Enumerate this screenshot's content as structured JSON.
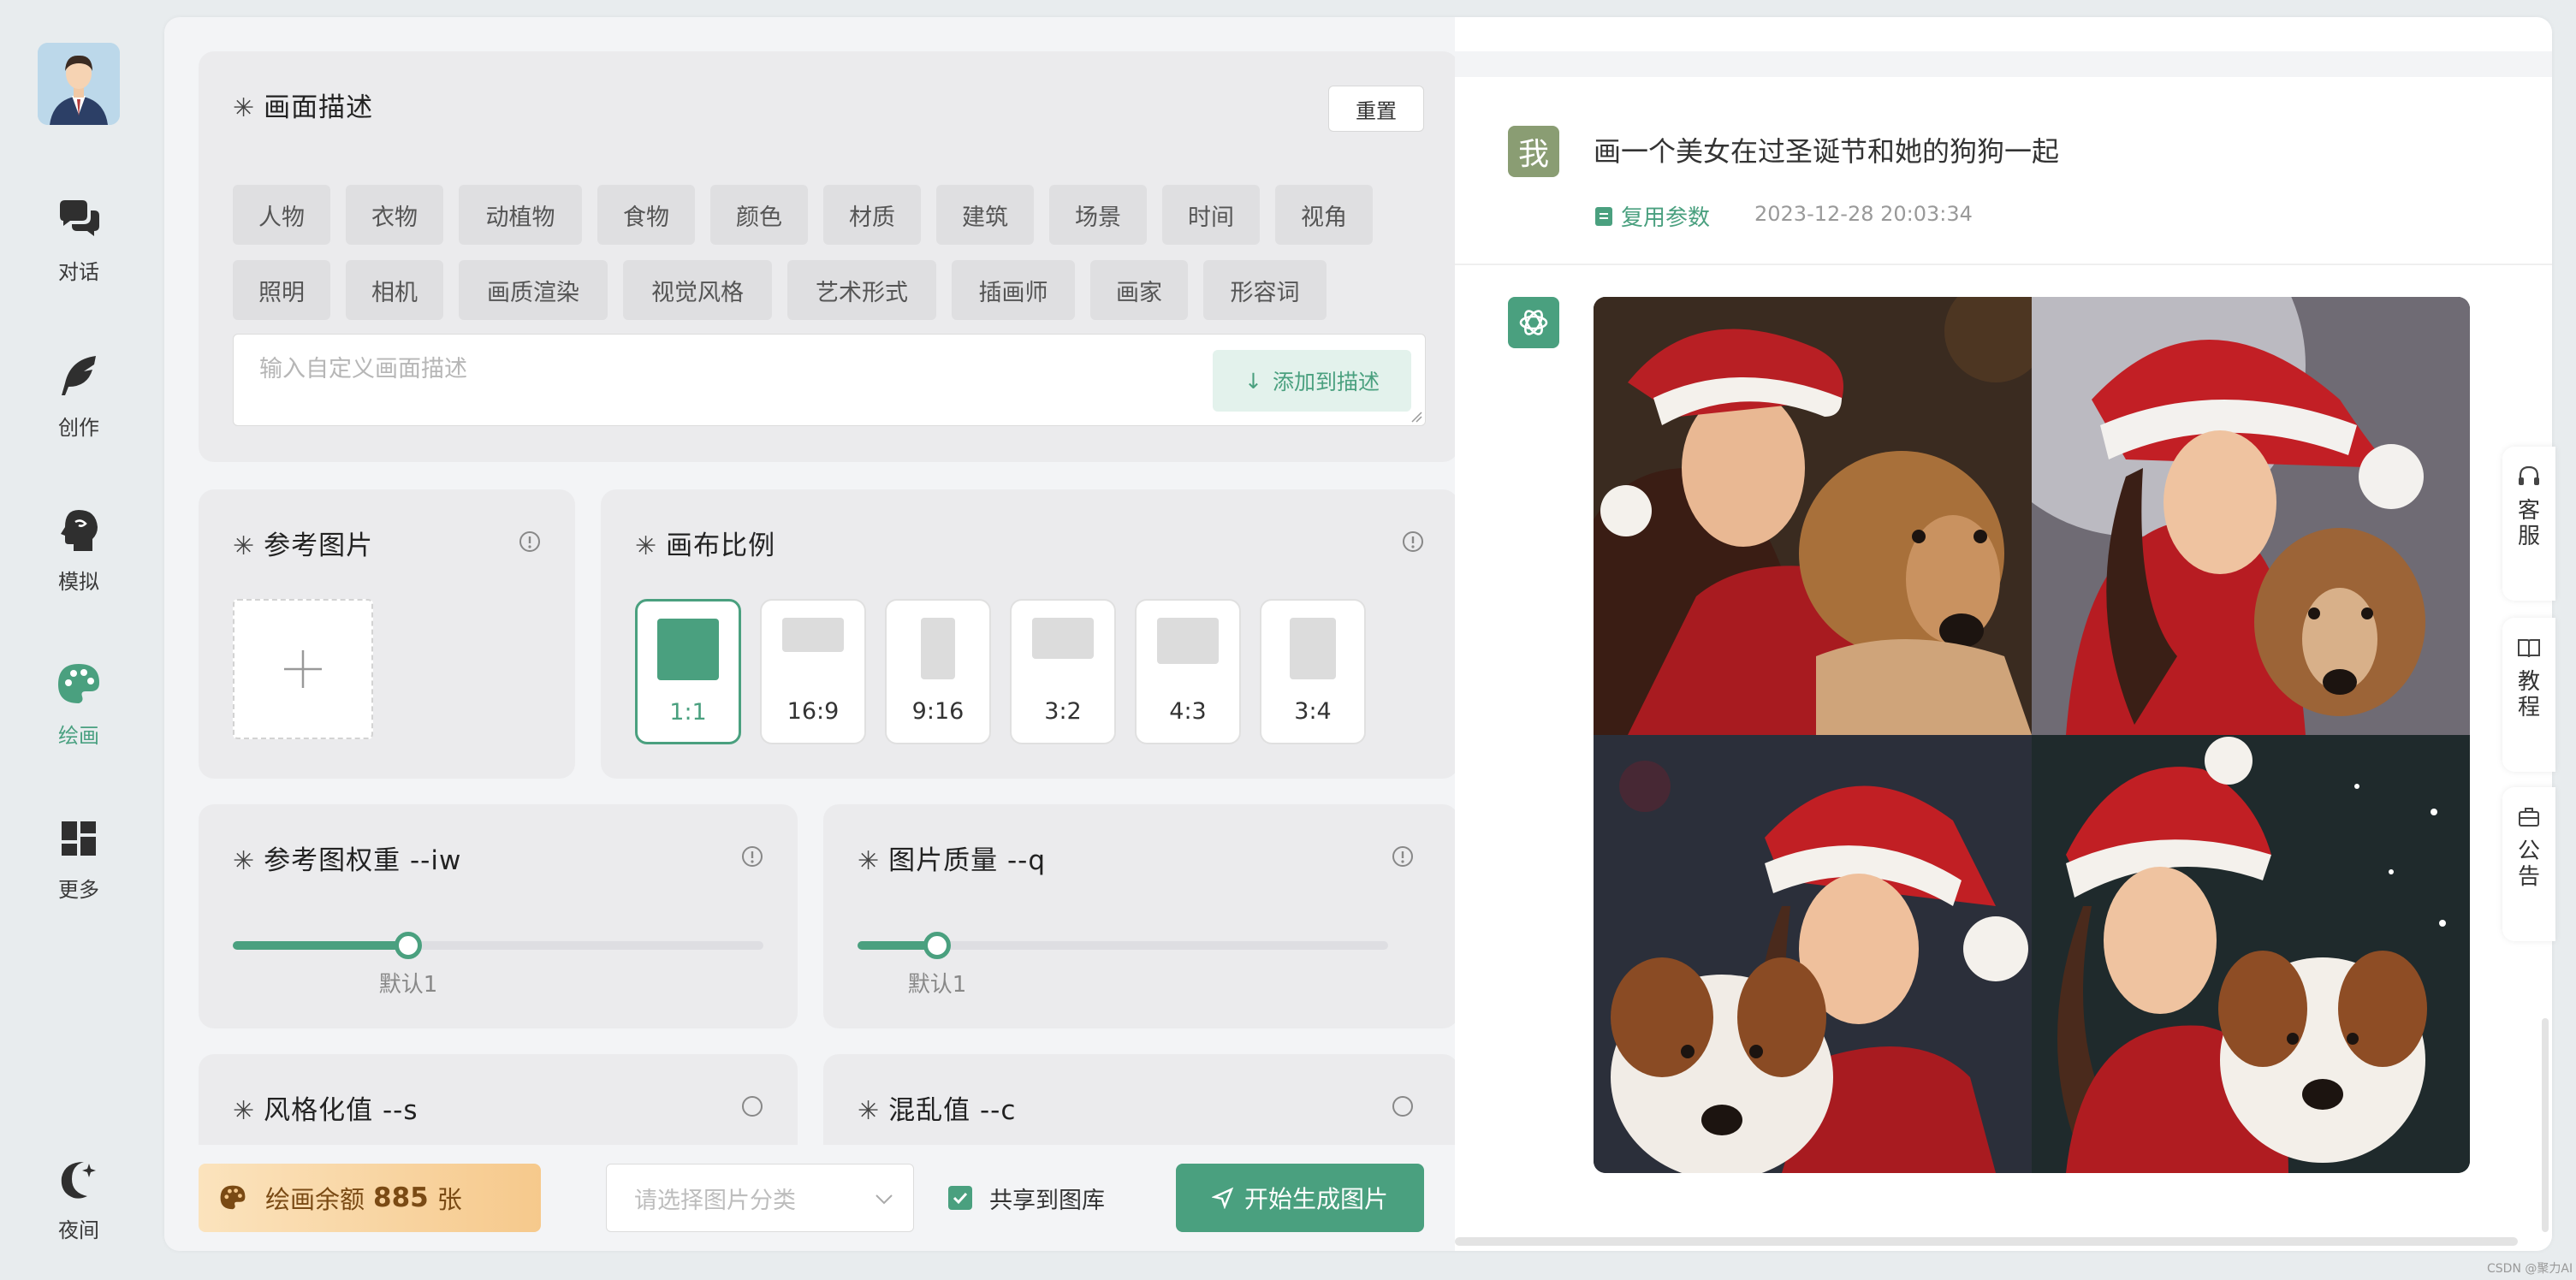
{
  "nav": {
    "items": [
      {
        "label": "对话",
        "icon": "chat-bubbles-icon"
      },
      {
        "label": "创作",
        "icon": "feather-icon"
      },
      {
        "label": "模拟",
        "icon": "head-profile-icon"
      },
      {
        "label": "绘画",
        "icon": "palette-icon",
        "active": true
      },
      {
        "label": "更多",
        "icon": "grid-icon"
      }
    ],
    "night_label": "夜间"
  },
  "description": {
    "title": "画面描述",
    "reset_label": "重置",
    "tags": [
      "人物",
      "衣物",
      "动植物",
      "食物",
      "颜色",
      "材质",
      "建筑",
      "场景",
      "时间",
      "视角",
      "照明",
      "相机",
      "画质渲染",
      "视觉风格",
      "艺术形式",
      "插画师",
      "画家",
      "形容词"
    ],
    "input_placeholder": "输入自定义画面描述",
    "add_button": "添加到描述"
  },
  "reference": {
    "title": "参考图片"
  },
  "canvas_ratio": {
    "title": "画布比例",
    "options": [
      "1:1",
      "16:9",
      "9:16",
      "3:2",
      "4:3",
      "3:4"
    ],
    "selected": "1:1"
  },
  "iw": {
    "title": "参考图权重 --iw",
    "caption": "默认1",
    "value_fraction": 0.33
  },
  "quality": {
    "title": "图片质量 --q",
    "caption": "默认1",
    "value_fraction": 0.15
  },
  "stylize": {
    "title": "风格化值 --s"
  },
  "chaos": {
    "title": "混乱值 --c"
  },
  "bottom": {
    "balance_prefix": "绘画余额",
    "balance_value": "885",
    "balance_unit": "张",
    "category_placeholder": "请选择图片分类",
    "share_label": "共享到图库",
    "share_checked": true,
    "generate_label": "开始生成图片"
  },
  "chat": {
    "user_badge": "我",
    "user_message": "画一个美女在过圣诞节和她的狗狗一起",
    "reuse_label": "复用参数",
    "timestamp": "2023-12-28 20:03:34"
  },
  "side_tabs": [
    {
      "label": "客服",
      "icon": "headset-icon"
    },
    {
      "label": "教程",
      "icon": "book-icon"
    },
    {
      "label": "公告",
      "icon": "notice-icon"
    }
  ],
  "watermark": "CSDN @聚力AI",
  "colors": {
    "accent": "#4aa07f",
    "balance_bg": "#f6c98c"
  }
}
